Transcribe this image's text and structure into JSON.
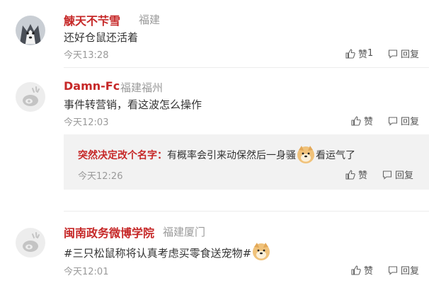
{
  "comments": [
    {
      "name": "觫天不芐雪",
      "location": "福建",
      "text": "还好仓鼠还活着",
      "time": "今天13:28",
      "like_label": "赞",
      "like_count": "1",
      "reply_label": "回复",
      "avatar_icon": "husky-avatar-icon"
    },
    {
      "name": "Damn-Fc",
      "location": "福建福州",
      "text": "事件转营销，看这波怎么操作",
      "time": "今天12:03",
      "like_label": "赞",
      "reply_label": "回复",
      "avatar_icon": "default-weibo-avatar-icon",
      "reply": {
        "name": "突然决定改个名字：",
        "text_before": "有概率会引来动保然后一身骚",
        "text_after": "看运气了",
        "emoji_icon": "doge-emoji-icon",
        "time": "今天12:26",
        "like_label": "赞",
        "reply_label": "回复"
      }
    },
    {
      "name": "闽南政务微博学院",
      "location": "福建厦门",
      "text": "#三只松鼠称将认真考虑买零食送宠物#",
      "emoji_icon": "doge-emoji-icon",
      "time": "今天12:01",
      "like_label": "赞",
      "reply_label": "回复",
      "avatar_icon": "default-weibo-avatar-icon"
    }
  ],
  "colors": {
    "name": "#c62828",
    "location": "#9a9a9a",
    "reply_bg": "#f2f2f2"
  }
}
